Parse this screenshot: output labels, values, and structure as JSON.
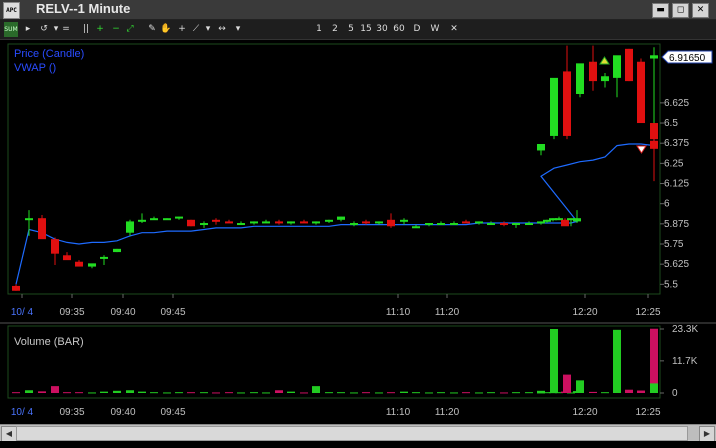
{
  "window": {
    "title": "RELV--1 Minute",
    "app_icon_text": "APC",
    "minimize": "▬",
    "maximize": "◻",
    "close": "✕"
  },
  "toolbar": {
    "items": [
      {
        "name": "summary-icon",
        "glyph": "SUM"
      },
      {
        "name": "nav-arrow-icon",
        "glyph": "▸"
      },
      {
        "name": "refresh-icon",
        "glyph": "↺"
      },
      {
        "name": "dropdown-arrow-icon",
        "glyph": "▾"
      },
      {
        "name": "equals-icon",
        "glyph": "="
      },
      {
        "name": "pause-icon",
        "glyph": "||"
      },
      {
        "name": "zoom-in-icon",
        "glyph": "+"
      },
      {
        "name": "zoom-out-icon",
        "glyph": "−"
      },
      {
        "name": "fit-icon",
        "glyph": "⤢"
      },
      {
        "name": "draw-icon",
        "glyph": "✎"
      },
      {
        "name": "hand-icon",
        "glyph": "✋"
      },
      {
        "name": "crosshair-icon",
        "glyph": "+"
      },
      {
        "name": "line-tool-icon",
        "glyph": "⟋"
      },
      {
        "name": "dropdown-arrow-icon",
        "glyph": "▾"
      },
      {
        "name": "scroll-lr-icon",
        "glyph": "↔"
      },
      {
        "name": "dropdown-arrow-icon",
        "glyph": "▾"
      }
    ],
    "intervals": [
      "1",
      "2",
      "5",
      "15",
      "30",
      "60",
      "D",
      "W"
    ],
    "close_glyph": "✕"
  },
  "price_panel": {
    "legend_price": "Price (Candle)",
    "legend_vwap": "VWAP ()",
    "last_price": "6.91650",
    "y_ticks": [
      "6.625",
      "6.5",
      "6.375",
      "6.25",
      "6.125",
      "6",
      "5.875",
      "5.75",
      "5.625",
      "5.5"
    ],
    "x_ticks": [
      "10/ 4",
      "09:35",
      "09:40",
      "09:45",
      "11:10",
      "11:20",
      "12:20",
      "12:25"
    ]
  },
  "volume_panel": {
    "legend": "Volume (BAR)",
    "y_ticks": [
      "23.3K",
      "11.7K",
      "0"
    ],
    "x_ticks": [
      "10/ 4",
      "09:35",
      "09:40",
      "09:45",
      "11:10",
      "11:20",
      "12:20",
      "12:25"
    ]
  },
  "colors": {
    "up": "#22dd22",
    "down": "#e01010",
    "vwap": "#1e6bff",
    "grid": "#1d4a1d",
    "axis_text": "#c0c0c0",
    "legend": "#2a4cff",
    "volume_up": "#22cc22",
    "volume_down": "#cc1060"
  },
  "chart_data": {
    "type": "candlestick",
    "x": [
      "09:31",
      "09:32",
      "09:33",
      "09:34",
      "09:35",
      "09:36",
      "09:37",
      "09:38",
      "09:39",
      "09:40",
      "09:41",
      "09:42",
      "09:43",
      "09:44",
      "09:45",
      "09:46",
      "09:47",
      "09:48",
      "09:49",
      "09:50",
      "09:51",
      "09:52",
      "09:53",
      "09:54",
      "09:55",
      "09:56",
      "09:57",
      "09:58",
      "09:59",
      "10:00",
      "10:01",
      "10:02",
      "10:03",
      "10:04",
      "10:05",
      "10:06",
      "10:07",
      "11:10",
      "11:12",
      "11:14",
      "11:16",
      "11:18",
      "11:20",
      "11:22",
      "11:24",
      "11:26",
      "11:28",
      "11:30",
      "11:32",
      "12:05",
      "12:10",
      "12:15",
      "12:17",
      "12:18",
      "12:19",
      "12:20",
      "12:21",
      "12:22",
      "12:23",
      "12:24",
      "12:25",
      "12:26"
    ],
    "open": [
      5.49,
      5.9,
      5.91,
      5.78,
      5.68,
      5.64,
      5.61,
      5.66,
      5.7,
      5.82,
      5.9,
      5.91,
      5.9,
      5.91,
      5.9,
      5.87,
      5.9,
      5.89,
      5.88,
      5.88,
      5.89,
      5.89,
      5.88,
      5.89,
      5.88,
      5.89,
      5.9,
      5.88,
      5.89,
      5.88,
      5.9,
      5.9,
      5.86,
      5.87,
      5.88,
      5.88,
      5.89,
      5.88,
      5.88,
      5.88,
      5.87,
      5.88,
      5.88,
      5.89,
      5.9,
      5.91,
      5.9,
      5.9,
      5.89,
      6.33,
      6.42,
      6.82,
      6.68,
      6.88,
      6.76,
      6.78,
      6.96,
      6.88,
      6.49,
      6.39,
      6.5,
      6.9
    ],
    "high": [
      5.5,
      5.96,
      5.93,
      5.79,
      5.7,
      5.65,
      5.62,
      5.68,
      5.72,
      5.9,
      5.94,
      5.92,
      5.91,
      5.92,
      5.9,
      5.89,
      5.91,
      5.9,
      5.89,
      5.89,
      5.9,
      5.9,
      5.89,
      5.9,
      5.89,
      5.9,
      5.92,
      5.89,
      5.9,
      5.89,
      5.94,
      5.91,
      5.87,
      5.88,
      5.89,
      5.89,
      5.9,
      5.89,
      5.89,
      5.89,
      5.88,
      5.89,
      5.89,
      5.9,
      5.91,
      5.92,
      5.91,
      5.91,
      5.96,
      6.36,
      6.55,
      6.98,
      6.79,
      6.98,
      6.81,
      6.84,
      6.96,
      6.9,
      6.6,
      6.42,
      6.53,
      6.97
    ],
    "low": [
      5.46,
      5.8,
      5.82,
      5.62,
      5.66,
      5.62,
      5.6,
      5.62,
      5.7,
      5.8,
      5.88,
      5.9,
      5.9,
      5.9,
      5.86,
      5.85,
      5.87,
      5.88,
      5.87,
      5.87,
      5.88,
      5.87,
      5.87,
      5.88,
      5.87,
      5.88,
      5.89,
      5.86,
      5.87,
      5.87,
      5.85,
      5.87,
      5.85,
      5.86,
      5.87,
      5.87,
      5.88,
      5.87,
      5.87,
      5.86,
      5.85,
      5.87,
      5.87,
      5.88,
      5.89,
      5.9,
      5.88,
      5.86,
      5.88,
      6.3,
      6.4,
      6.4,
      6.66,
      6.7,
      6.72,
      6.66,
      6.76,
      6.77,
      6.35,
      6.34,
      6.14,
      6.5
    ],
    "close": [
      5.46,
      5.91,
      5.78,
      5.69,
      5.65,
      5.61,
      5.63,
      5.67,
      5.72,
      5.89,
      5.9,
      5.91,
      5.91,
      5.92,
      5.86,
      5.88,
      5.89,
      5.88,
      5.88,
      5.89,
      5.89,
      5.88,
      5.89,
      5.88,
      5.89,
      5.9,
      5.92,
      5.88,
      5.88,
      5.89,
      5.86,
      5.9,
      5.86,
      5.88,
      5.88,
      5.88,
      5.88,
      5.89,
      5.88,
      5.87,
      5.88,
      5.88,
      5.89,
      5.9,
      5.91,
      5.91,
      5.86,
      5.91,
      5.91,
      6.37,
      6.78,
      6.42,
      6.87,
      6.76,
      6.79,
      6.92,
      6.76,
      6.5,
      6.49,
      6.34,
      6.4,
      6.92
    ],
    "vwap": [
      5.5,
      5.84,
      5.82,
      5.78,
      5.76,
      5.75,
      5.76,
      5.76,
      5.77,
      5.8,
      5.82,
      5.82,
      5.83,
      5.83,
      5.83,
      5.84,
      5.85,
      5.85,
      5.85,
      5.86,
      5.86,
      5.86,
      5.86,
      5.86,
      5.86,
      5.86,
      5.87,
      5.87,
      5.87,
      5.87,
      5.87,
      5.87,
      5.87,
      5.87,
      5.87,
      5.87,
      5.87,
      5.88,
      5.88,
      5.88,
      5.88,
      5.88,
      5.88,
      5.88,
      5.88,
      5.88,
      5.88,
      5.88,
      5.89,
      6.17,
      6.22,
      6.24,
      6.26,
      6.27,
      6.29,
      6.36,
      6.37,
      6.37,
      6.36,
      6.37,
      6.38,
      6.4
    ],
    "volume": [
      0.3,
      1.0,
      0.6,
      2.5,
      0.3,
      0.3,
      0.2,
      0.5,
      0.8,
      1.0,
      0.5,
      0.3,
      0.2,
      0.3,
      0.3,
      0.3,
      0.2,
      0.3,
      0.2,
      0.3,
      0.2,
      1.0,
      0.5,
      0.2,
      2.5,
      0.3,
      0.3,
      0.2,
      0.3,
      0.2,
      0.3,
      0.5,
      0.3,
      0.2,
      0.3,
      0.2,
      0.3,
      0.2,
      0.3,
      0.2,
      0.3,
      0.3,
      0.2,
      0.3,
      0.3,
      0.3,
      0.5,
      0.2,
      0.7,
      0.8,
      23.3,
      6.7,
      4.6,
      0.4,
      0.3,
      23.0,
      1.2,
      0.9,
      1.5,
      0.8,
      23.4,
      3.5
    ],
    "ylim": [
      5.44,
      6.99
    ],
    "volume_ylim": [
      0,
      23.3
    ],
    "volume_unit": "K"
  }
}
